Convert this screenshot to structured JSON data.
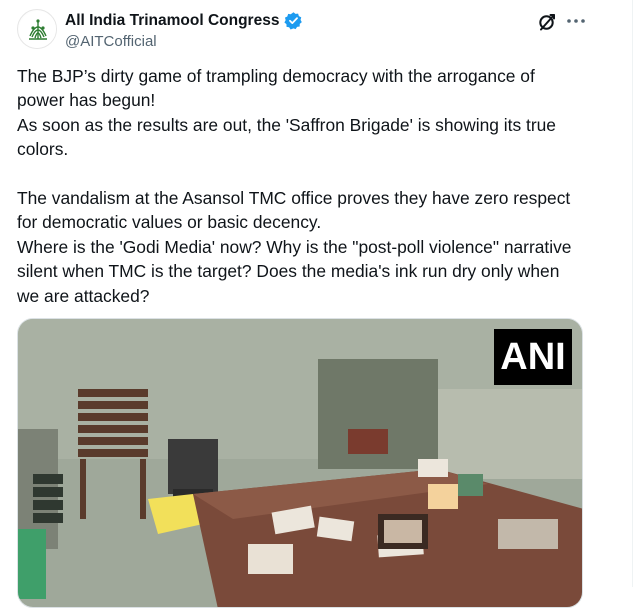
{
  "author": {
    "display_name": "All India Trinamool Congress",
    "handle": "@AITCofficial"
  },
  "icons": {
    "avatar": "aitc-logo-avatar",
    "verified": "verified-badge-icon",
    "grok": "grok-icon",
    "more": "more-options-icon"
  },
  "tweet": {
    "lines": [
      "The BJP’s dirty game of trampling democracy with the arrogance of",
      "power has begun!",
      "As soon as the results are out, the 'Saffron Brigade' is showing its true",
      "colors.",
      "",
      "The vandalism at the Asansol TMC office proves they have zero respect",
      "for democratic values or basic decency.",
      "Where is the 'Godi Media' now? Why is the \"post-poll violence\" narrative",
      "silent when TMC is the target? Does the media's ink run dry only when",
      "we are attacked?"
    ]
  },
  "media": {
    "watermark": "ANI"
  },
  "colors": {
    "text": "#0f1419",
    "secondary": "#536471",
    "verified": "#1d9bf0"
  }
}
